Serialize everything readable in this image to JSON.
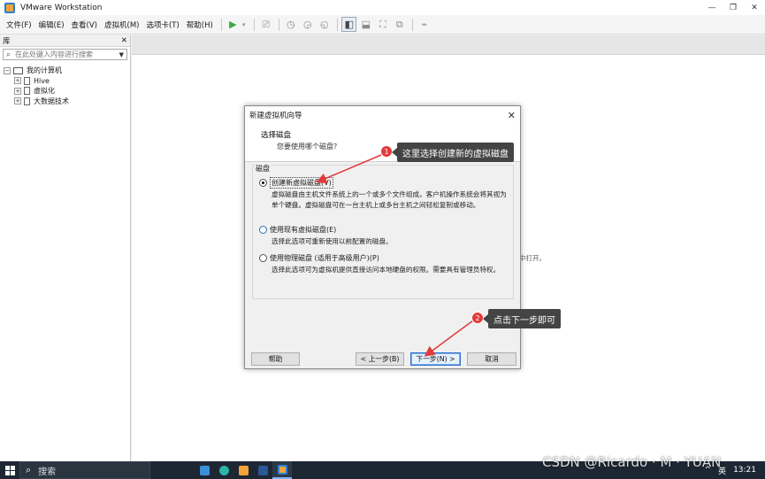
{
  "window": {
    "title": "VMware Workstation",
    "controls": {
      "minimize": "—",
      "restore": "❐",
      "close": "✕"
    }
  },
  "menu": [
    "文件(F)",
    "编辑(E)",
    "查看(V)",
    "虚拟机(M)",
    "选项卡(T)",
    "帮助(H)"
  ],
  "library": {
    "title": "库",
    "close": "✕",
    "search_placeholder": "在此处键入内容进行搜索",
    "tree": {
      "root": "我的计算机",
      "children": [
        "Hive",
        "虚拟化",
        "大数据技术"
      ]
    }
  },
  "main": {
    "hint_text": "中打开。"
  },
  "dialog": {
    "title": "新建虚拟机向导",
    "close": "✕",
    "heading": "选择磁盘",
    "subheading": "您要使用哪个磁盘?",
    "group_label": "磁盘",
    "options": [
      {
        "label": "创建新虚拟磁盘(V)",
        "description": "虚拟磁盘由主机文件系统上的一个或多个文件组成，客户机操作系统会将其视为单个硬盘。虚拟磁盘可在一台主机上或多台主机之间轻松复制或移动。",
        "selected": true
      },
      {
        "label": "使用现有虚拟磁盘(E)",
        "description": "选择此选项可重新使用以前配置的磁盘。",
        "selected": false
      },
      {
        "label": "使用物理磁盘 (适用于高级用户)(P)",
        "description": "选择此选项可为虚拟机提供直接访问本地硬盘的权限。需要具有管理员特权。",
        "selected": false
      }
    ],
    "buttons": {
      "help": "帮助",
      "back": "< 上一步(B)",
      "next": "下一步(N) >",
      "cancel": "取消"
    }
  },
  "annotations": [
    {
      "number": "1",
      "text": "这里选择创建新的虚拟磁盘"
    },
    {
      "number": "2",
      "text": "点击下一步即可"
    }
  ],
  "taskbar": {
    "search_label": "搜索",
    "tray": {
      "chevron": "^",
      "ime": "英",
      "time": "13:21"
    }
  },
  "watermark": "CSDN @Ricardo · M · YUAN",
  "colors": {
    "annotation_badge": "#e23b3b",
    "annotation_bg": "#444444",
    "arrow": "#e23b3b",
    "taskbar": "#1c2733"
  }
}
